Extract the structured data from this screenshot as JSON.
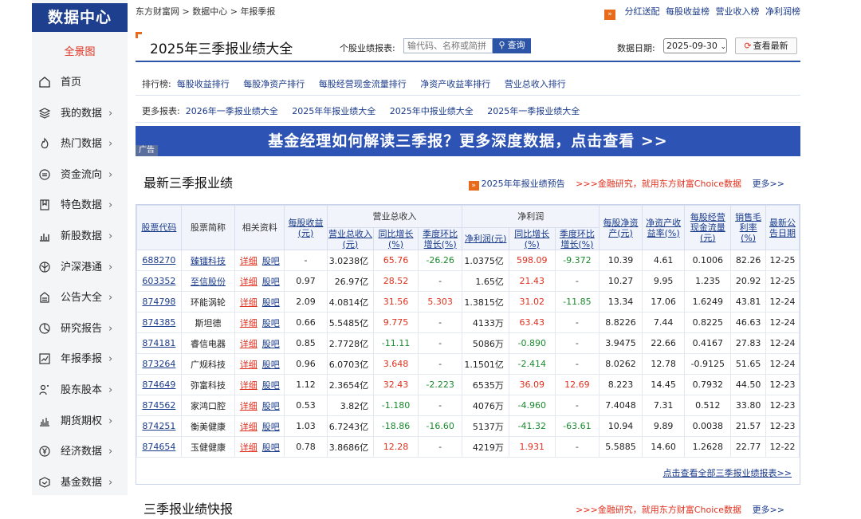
{
  "sidebar": {
    "logo": "数据中心",
    "panorama": "全景图",
    "items": [
      {
        "label": "首页",
        "icon": "home-icon",
        "arrow": ""
      },
      {
        "label": "我的数据",
        "icon": "layers-icon",
        "arrow": "›"
      },
      {
        "label": "热门数据",
        "icon": "flame-icon",
        "arrow": "›"
      },
      {
        "label": "资金流向",
        "icon": "flow-icon",
        "arrow": "›"
      },
      {
        "label": "特色数据",
        "icon": "bookmark-icon",
        "arrow": "›"
      },
      {
        "label": "新股数据",
        "icon": "bar-chart-icon",
        "arrow": "›"
      },
      {
        "label": "沪深港通",
        "icon": "globe-icon",
        "arrow": "›"
      },
      {
        "label": "公告大全",
        "icon": "announce-icon",
        "arrow": "›"
      },
      {
        "label": "研究报告",
        "icon": "pie-icon",
        "arrow": "›"
      },
      {
        "label": "年报季报",
        "icon": "chart-report-icon",
        "arrow": "›"
      },
      {
        "label": "股东股本",
        "icon": "shareholder-icon",
        "arrow": "›"
      },
      {
        "label": "期货期权",
        "icon": "futures-icon",
        "arrow": "›"
      },
      {
        "label": "经济数据",
        "icon": "yen-icon",
        "arrow": "›"
      },
      {
        "label": "基金数据",
        "icon": "fund-icon",
        "arrow": "›"
      }
    ]
  },
  "topbar": {
    "breadcrumb": [
      "东方财富网",
      "数据中心",
      "年报季报"
    ],
    "sep": ">",
    "links": [
      "分红送配",
      "每股收益榜",
      "营业收入榜",
      "净利润榜"
    ]
  },
  "titlebar": {
    "title": "2025年三季报业绩大全",
    "search_label": "个股业绩报表:",
    "search_placeholder": "输代码、名称或简拼",
    "search_button": "查询",
    "date_label": "数据日期:",
    "date_value": "2025-09-30",
    "refresh_button": "查看最新"
  },
  "ranking": {
    "label": "排行榜:",
    "links": [
      "每股收益排行",
      "每股净资产排行",
      "每股经营现金流量排行",
      "净资产收益率排行",
      "营业总收入排行"
    ]
  },
  "more_reports": {
    "label": "更多报表:",
    "links": [
      "2026年一季报业绩大全",
      "2025年年报业绩大全",
      "2025年中报业绩大全",
      "2025年一季报业绩大全"
    ]
  },
  "banner": {
    "ad": "广告",
    "text": "基金经理如何解读三季报？更多深度数据，点击查看 >>"
  },
  "section1": {
    "title": "最新三季报业绩",
    "forecast_link": "2025年年报业绩预告",
    "choice_link": ">>>金融研究，就用东方财富Choice数据",
    "more_link": "更多>>"
  },
  "table": {
    "headers": {
      "code": "股票代码",
      "name": "股票简称",
      "related": "相关资料",
      "eps": "每股收益(元)",
      "revenue_group": "营业总收入",
      "profit_group": "净利润",
      "rev_total": "营业总收入(元)",
      "rev_yoy": "同比增长(%)",
      "rev_qoq": "季度环比增长(%)",
      "np": "净利润(元)",
      "np_yoy": "同比增长(%)",
      "np_qoq": "季度环比增长(%)",
      "bvps": "每股净资产(元)",
      "roe": "净资产收益率(%)",
      "ocf": "每股经营现金流量(元)",
      "gm": "销售毛利率(%)",
      "date": "最新公告日期"
    },
    "link_detail": "详细",
    "link_guba": "股吧",
    "rows": [
      {
        "code": "688270",
        "name": "臻镭科技",
        "name_link": true,
        "eps": "-",
        "rev": "3.0238亿",
        "rev_yoy": "65.76",
        "rev_qoq": "-26.26",
        "np": "1.0375亿",
        "np_yoy": "598.09",
        "np_qoq": "-9.372",
        "bvps": "10.39",
        "roe": "4.61",
        "ocf": "0.1006",
        "gm": "82.26",
        "date": "12-25"
      },
      {
        "code": "603352",
        "name": "至信股份",
        "name_link": true,
        "eps": "0.97",
        "rev": "26.97亿",
        "rev_yoy": "28.52",
        "rev_qoq": "-",
        "np": "1.65亿",
        "np_yoy": "21.43",
        "np_qoq": "-",
        "bvps": "10.27",
        "roe": "9.95",
        "ocf": "1.235",
        "gm": "20.92",
        "date": "12-25"
      },
      {
        "code": "874798",
        "name": "环能涡轮",
        "name_link": false,
        "eps": "2.09",
        "rev": "4.0814亿",
        "rev_yoy": "31.56",
        "rev_qoq": "5.303",
        "np": "1.3815亿",
        "np_yoy": "31.02",
        "np_qoq": "-11.85",
        "bvps": "13.34",
        "roe": "17.06",
        "ocf": "1.6249",
        "gm": "43.81",
        "date": "12-24"
      },
      {
        "code": "874385",
        "name": "斯坦德",
        "name_link": false,
        "eps": "0.66",
        "rev": "5.5485亿",
        "rev_yoy": "9.775",
        "rev_qoq": "-",
        "np": "4133万",
        "np_yoy": "63.43",
        "np_qoq": "-",
        "bvps": "8.8226",
        "roe": "7.44",
        "ocf": "0.8225",
        "gm": "46.63",
        "date": "12-24"
      },
      {
        "code": "874181",
        "name": "睿信电器",
        "name_link": false,
        "eps": "0.85",
        "rev": "2.7728亿",
        "rev_yoy": "-11.11",
        "rev_qoq": "-",
        "np": "5086万",
        "np_yoy": "-0.890",
        "np_qoq": "-",
        "bvps": "3.9475",
        "roe": "22.66",
        "ocf": "0.4167",
        "gm": "27.83",
        "date": "12-24"
      },
      {
        "code": "873264",
        "name": "广规科技",
        "name_link": false,
        "eps": "0.96",
        "rev": "6.0703亿",
        "rev_yoy": "3.648",
        "rev_qoq": "-",
        "np": "1.1501亿",
        "np_yoy": "-2.414",
        "np_qoq": "-",
        "bvps": "8.0262",
        "roe": "12.78",
        "ocf": "-0.9125",
        "gm": "51.65",
        "date": "12-24"
      },
      {
        "code": "874649",
        "name": "弥富科技",
        "name_link": false,
        "eps": "1.12",
        "rev": "2.3654亿",
        "rev_yoy": "32.43",
        "rev_qoq": "-2.223",
        "np": "6535万",
        "np_yoy": "36.09",
        "np_qoq": "12.69",
        "bvps": "8.223",
        "roe": "14.45",
        "ocf": "0.7932",
        "gm": "44.50",
        "date": "12-23"
      },
      {
        "code": "874562",
        "name": "家鸿口腔",
        "name_link": false,
        "eps": "0.53",
        "rev": "3.82亿",
        "rev_yoy": "-1.180",
        "rev_qoq": "-",
        "np": "4076万",
        "np_yoy": "-4.960",
        "np_qoq": "-",
        "bvps": "7.4048",
        "roe": "7.31",
        "ocf": "0.512",
        "gm": "33.80",
        "date": "12-23"
      },
      {
        "code": "874251",
        "name": "衡美健康",
        "name_link": false,
        "eps": "1.03",
        "rev": "6.7243亿",
        "rev_yoy": "-18.86",
        "rev_qoq": "-16.60",
        "np": "5137万",
        "np_yoy": "-41.32",
        "np_qoq": "-63.61",
        "bvps": "10.94",
        "roe": "9.89",
        "ocf": "0.0038",
        "gm": "21.57",
        "date": "12-23"
      },
      {
        "code": "874654",
        "name": "玉健健康",
        "name_link": false,
        "eps": "0.78",
        "rev": "3.8686亿",
        "rev_yoy": "12.28",
        "rev_qoq": "-",
        "np": "4219万",
        "np_yoy": "1.931",
        "np_qoq": "-",
        "bvps": "5.5885",
        "roe": "14.60",
        "ocf": "1.2628",
        "gm": "22.77",
        "date": "12-22"
      }
    ],
    "more_link": "点击查看全部三季报业绩报表>>"
  },
  "section2": {
    "title": "三季报业绩快报",
    "choice_link": ">>>金融研究，就用东方财富Choice数据",
    "more_link": "更多>>"
  },
  "colors": {
    "brand_blue": "#1d3f8d",
    "link_blue": "#1a3a8b",
    "up_red": "#e0301e",
    "down_green": "#1a8a2e",
    "banner_blue": "#2d53b4",
    "accent_orange": "#e86a1a"
  }
}
